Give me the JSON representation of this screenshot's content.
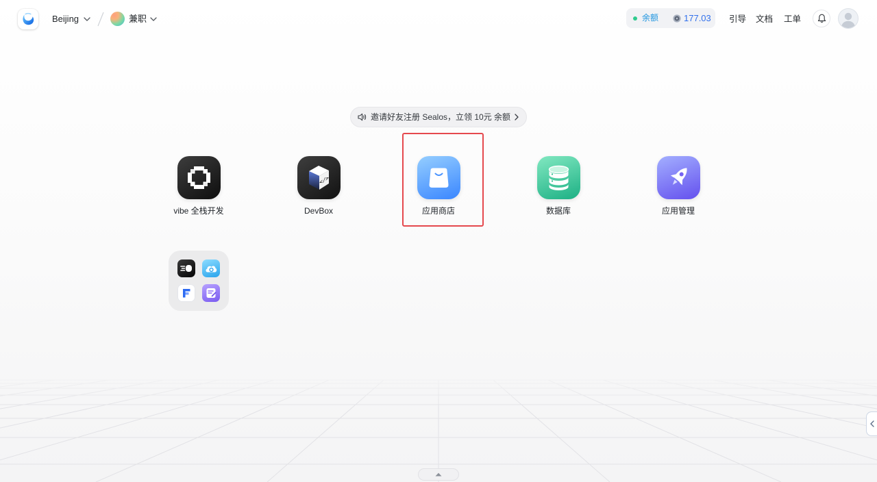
{
  "topbar": {
    "logo": "sealos-logo",
    "region": "Beijing",
    "workspace": "兼职",
    "balance": {
      "label": "余额",
      "value": "177.03",
      "icon": "coin-icon"
    },
    "nav": [
      {
        "label": "引导"
      },
      {
        "label": "文档"
      },
      {
        "label": "工单"
      }
    ],
    "notifications_icon": "bell-icon",
    "avatar_icon": "user-avatar-icon"
  },
  "announcement": {
    "icon": "speaker-icon",
    "text": "邀请好友注册 Sealos，立领 10元 余额",
    "arrow_icon": "chevron-right-icon"
  },
  "apps": [
    {
      "label": "vibe 全栈开发",
      "icon": "vibe-icon"
    },
    {
      "label": "DevBox",
      "icon": "devbox-icon"
    },
    {
      "label": "应用商店",
      "icon": "app-store-icon",
      "highlighted": true
    },
    {
      "label": "数据库",
      "icon": "database-icon"
    },
    {
      "label": "应用管理",
      "icon": "app-launchpad-icon"
    }
  ],
  "folder": {
    "icons": [
      "speed-icon",
      "cloud-icon",
      "f-logo-icon",
      "edit-doc-icon"
    ]
  },
  "controls": {
    "bottom_toggle_icon": "caret-up-icon",
    "side_toggle_icon": "chevron-left-icon"
  },
  "colors": {
    "accent": "#3271EC",
    "status_dot": "#2FCB8E",
    "highlight_border": "#E5484D",
    "app_store": "#3A86FF",
    "database": "#1CB084",
    "app_launchpad": "#6450EE"
  }
}
